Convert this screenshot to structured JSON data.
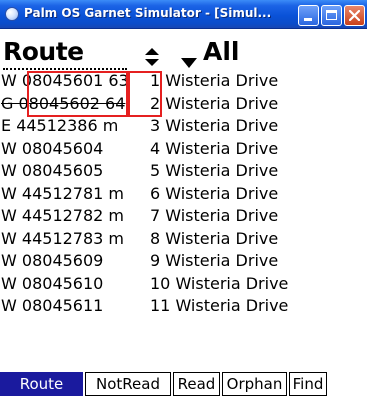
{
  "window": {
    "title": "Palm OS Garnet Simulator - [Simul...",
    "icons": {
      "app": "palm-app-icon",
      "minimize": "minimize-icon",
      "maximize": "maximize-icon",
      "close": "close-icon"
    },
    "colors": {
      "titlebar": "#0a52d8",
      "close": "#c9401a"
    }
  },
  "header": {
    "title": "Route",
    "sort_icon": "sort-up-down-icon",
    "filter_icon": "dropdown-triangle-icon",
    "filter_value": "All"
  },
  "list": {
    "items": [
      {
        "meter": "W 08045601 63",
        "address": "1 Wisteria Drive"
      },
      {
        "meter": "G 08045602 64",
        "address": "2 Wisteria Drive"
      },
      {
        "meter": "E 44512386 m",
        "address": "3 Wisteria Drive"
      },
      {
        "meter": "W 08045604",
        "address": "4 Wisteria Drive"
      },
      {
        "meter": "W 08045605",
        "address": "5 Wisteria Drive"
      },
      {
        "meter": "W 44512781 m",
        "address": "6 Wisteria Drive"
      },
      {
        "meter": "W 44512782 m",
        "address": "7 Wisteria Drive"
      },
      {
        "meter": "W 44512783 m",
        "address": "8 Wisteria Drive"
      },
      {
        "meter": "W 08045609",
        "address": "9 Wisteria Drive"
      },
      {
        "meter": "W 08045610",
        "address": "10 Wisteria Drive"
      },
      {
        "meter": "W 08045611",
        "address": "11 Wisteria Drive"
      }
    ]
  },
  "annotations": {
    "color": "#e52020"
  },
  "toolbar": {
    "buttons": [
      {
        "label": "Route",
        "active": true
      },
      {
        "label": "NotRead",
        "active": false
      },
      {
        "label": "Read",
        "active": false
      },
      {
        "label": "Orphan",
        "active": false
      },
      {
        "label": "Find",
        "active": false
      }
    ],
    "active_color": "#1a1a9e"
  }
}
